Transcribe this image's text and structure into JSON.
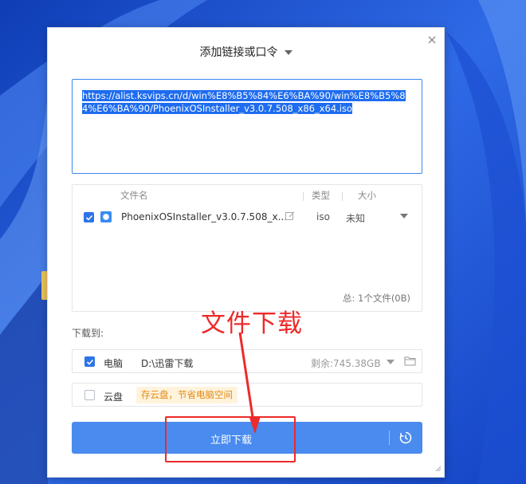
{
  "dialog": {
    "title": "添加链接或口令"
  },
  "url_input": {
    "value": "https://alist.ksvips.cn/d/win%E8%B5%84%E6%BA%90/win%E8%B5%84%E6%BA%90/PhoenixOSInstaller_v3.0.7.508_x86_x64.iso"
  },
  "file_list": {
    "columns": {
      "name": "文件名",
      "type": "类型",
      "size": "大小"
    },
    "rows": [
      {
        "name": "PhoenixOSInstaller_v3.0.7.508_x...",
        "type": "iso",
        "size": "未知",
        "checked": true
      }
    ],
    "total": "总:  1个文件(0B)"
  },
  "save_to": {
    "label": "下载到:",
    "computer": {
      "label": "电脑",
      "path": "D:\\迅雷下载",
      "free": "剩余:745.38GB",
      "checked": true
    },
    "cloud": {
      "label": "云盘",
      "tag": "存云盘，节省电脑空间",
      "checked": false
    }
  },
  "download_button": {
    "label": "立即下载"
  },
  "annotation": {
    "text": "文件下载",
    "color": "#ee2a2a"
  },
  "colors": {
    "accent": "#4a8bef",
    "selection": "#1e6cf0",
    "tag_bg": "#fff3dc",
    "tag_text": "#e38a14"
  }
}
